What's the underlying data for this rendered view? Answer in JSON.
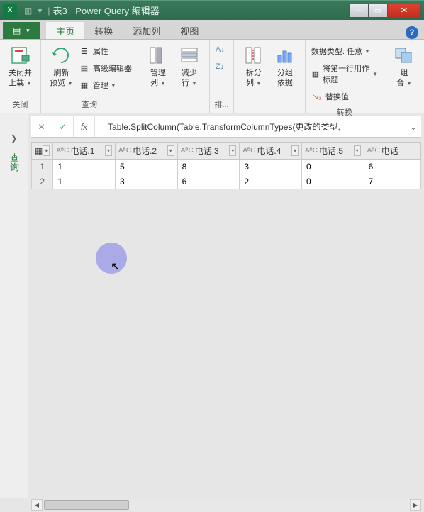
{
  "window": {
    "app_icon_text": "X",
    "doc_name": "表3",
    "app_name": "Power Query 编辑器"
  },
  "tabs": {
    "file_label": "文件",
    "items": [
      "主页",
      "转换",
      "添加列",
      "视图"
    ],
    "active_index": 0
  },
  "ribbon": {
    "close_group": {
      "close_load": "关闭并\n上载",
      "label": "关闭"
    },
    "query_group": {
      "refresh": "刷新\n预览",
      "props": "属性",
      "adv_editor": "高级编辑器",
      "manage": "管理",
      "label": "查询"
    },
    "columns_group": {
      "manage_cols": "管理\n列",
      "reduce_rows": "减少\n行"
    },
    "sort_group": {
      "label": "排..."
    },
    "split_group": {
      "split": "拆分\n列",
      "group": "分组\n依据"
    },
    "transform_group": {
      "datatype": "数据类型: 任意",
      "first_row": "将第一行用作标题",
      "replace": "替换值",
      "label": "转换"
    },
    "combine_group": {
      "combine": "组\n合"
    }
  },
  "formula": {
    "text": "= Table.SplitColumn(Table.TransformColumnTypes(更改的类型,"
  },
  "left_panel": {
    "queries": "查询"
  },
  "grid": {
    "columns": [
      "电话.1",
      "电话.2",
      "电话.3",
      "电话.4",
      "电话.5",
      "电话"
    ],
    "type_prefix": "AᴮC",
    "rows": [
      [
        "1",
        "5",
        "8",
        "3",
        "0",
        "6"
      ],
      [
        "1",
        "3",
        "6",
        "2",
        "0",
        "7"
      ]
    ]
  },
  "chart_data": {
    "type": "table",
    "columns": [
      "电话.1",
      "电话.2",
      "电话.3",
      "电话.4",
      "电话.5",
      "电话"
    ],
    "rows": [
      [
        1,
        5,
        8,
        3,
        0,
        6
      ],
      [
        1,
        3,
        6,
        2,
        0,
        7
      ]
    ]
  }
}
